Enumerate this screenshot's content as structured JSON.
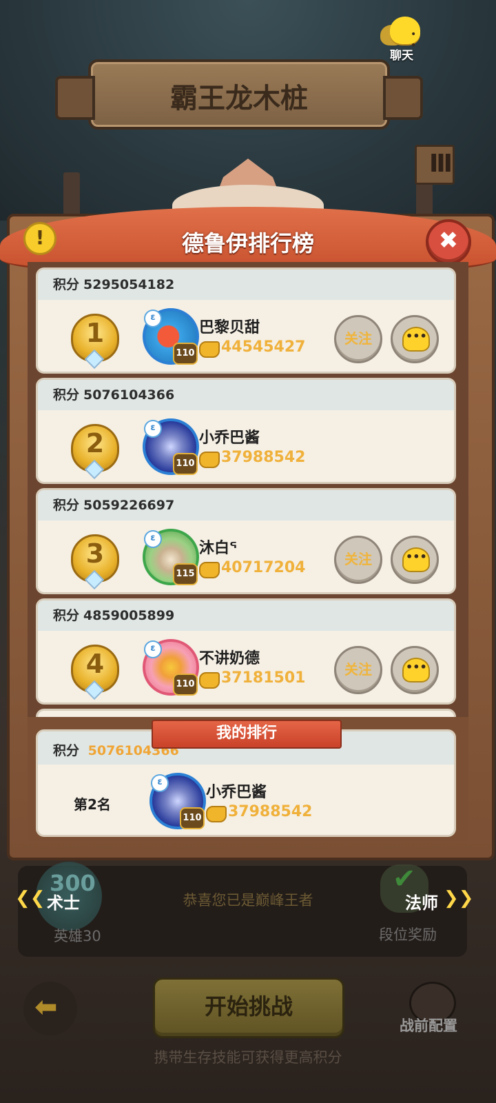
{
  "header": {
    "title": "霸王龙木桩",
    "chat_label": "聊天",
    "scroll_glyph": "Ⅲ"
  },
  "panel": {
    "title": "德鲁伊排行榜",
    "info_glyph": "!",
    "close_glyph": "✖"
  },
  "score_label": "积分",
  "follow_label": "关注",
  "leaderboard": [
    {
      "rank": "1",
      "score": "5295054182",
      "name": "巴黎贝甜",
      "level": "110",
      "power": "44545427",
      "avatar": "fish-avatar",
      "has_actions": true
    },
    {
      "rank": "2",
      "score": "5076104366",
      "name": "小乔巴酱",
      "level": "110",
      "power": "37988542",
      "avatar": "blade-avatar",
      "has_actions": false
    },
    {
      "rank": "3",
      "score": "5059226697",
      "name": "沐白ᕐ",
      "level": "115",
      "power": "40717204",
      "avatar": "bird-avatar",
      "has_actions": true
    },
    {
      "rank": "4",
      "score": "4859005899",
      "name": "不讲奶德",
      "level": "110",
      "power": "37181501",
      "avatar": "pink-avatar",
      "has_actions": true
    }
  ],
  "my_rank": {
    "ribbon": "我的排行",
    "score": "5076104366",
    "rank_text": "第2名",
    "name": "小乔巴酱",
    "level": "110",
    "power": "37988542"
  },
  "bottom": {
    "hero_number": "300",
    "hero_count": "英雄30",
    "left_arrows": "❮❮",
    "left_class": "术士",
    "right_class": "法师",
    "right_arrows": "❯❯",
    "congrats": "恭喜您已是巅峰王者",
    "reward_label": "段位奖励",
    "back_glyph": "⬅",
    "start_label": "开始挑战",
    "config_label": "战前配置",
    "tip": "携带生存技能可获得更高积分"
  },
  "colors": {
    "accent_gold": "#f0b13b",
    "panel_red": "#d84f3f",
    "card_bg": "#f5efe4"
  }
}
